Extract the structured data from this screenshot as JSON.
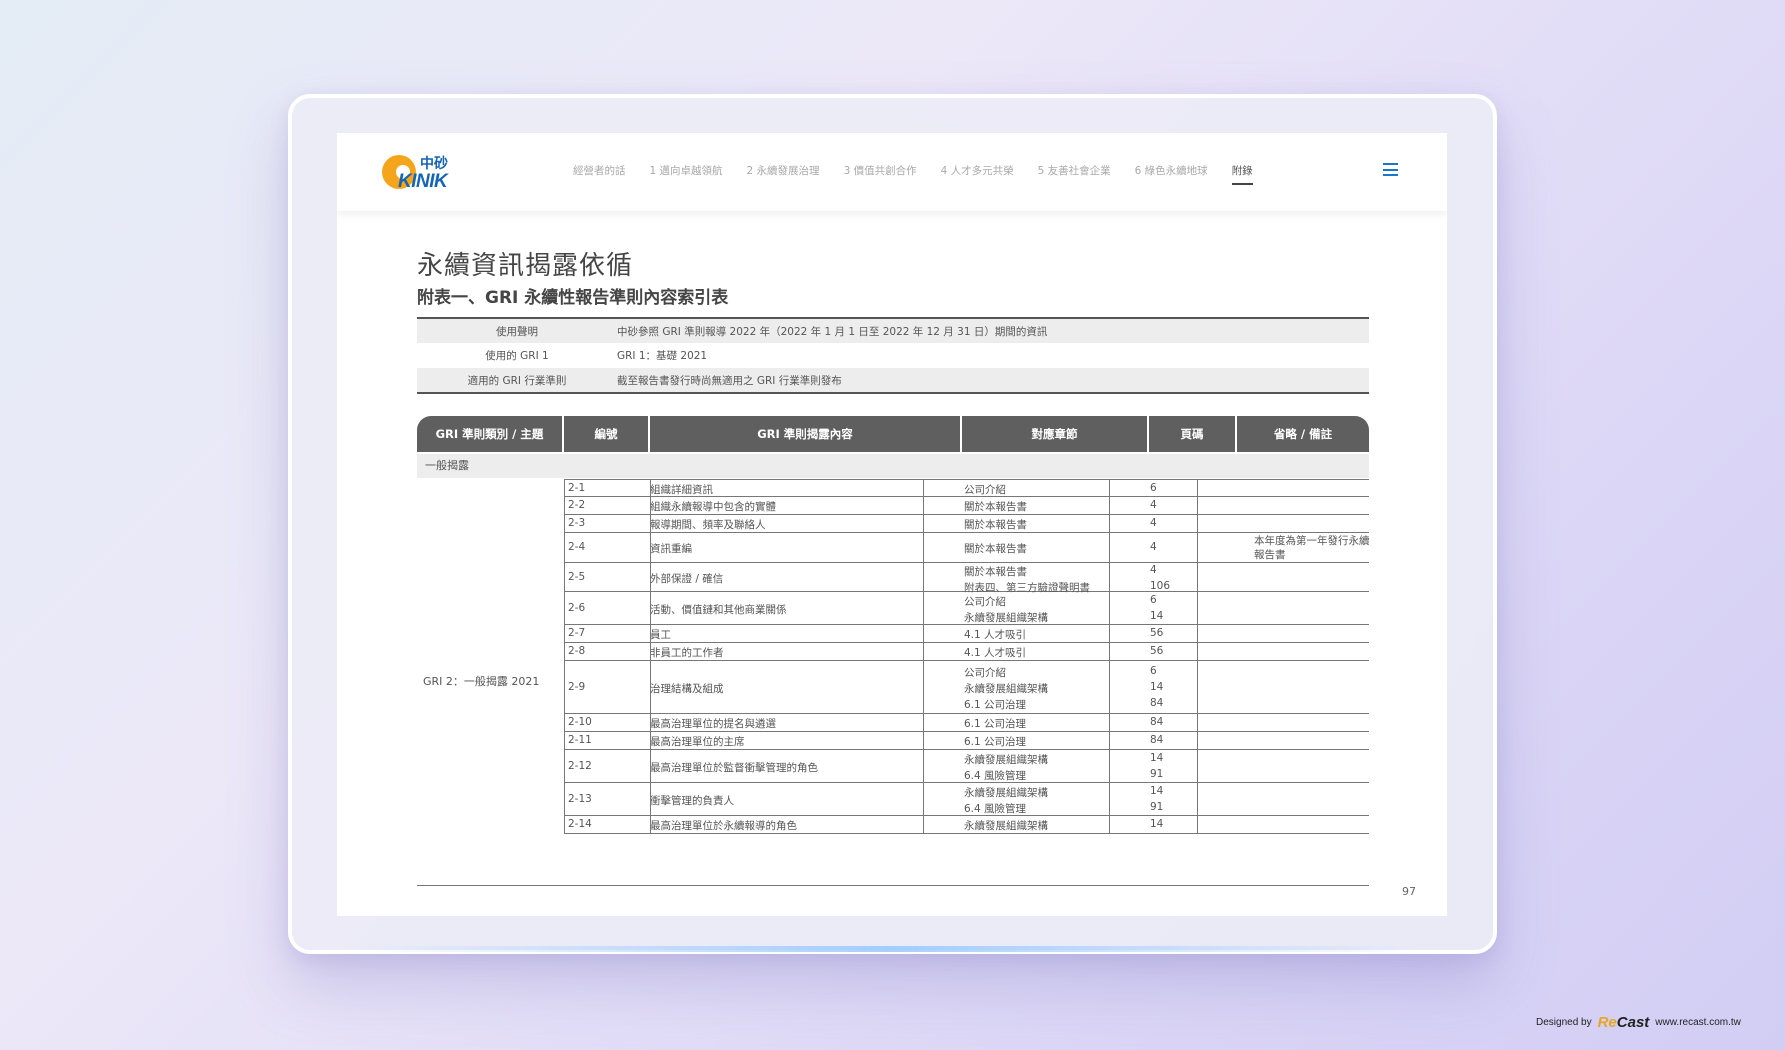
{
  "brand": {
    "logo_zh": "中砂",
    "logo_en": "KINIK"
  },
  "nav": {
    "items": [
      "經營者的話",
      "1 邁向卓越領航",
      "2 永續發展治理",
      "3 價值共創合作",
      "4 人才多元共榮",
      "5 友善社會企業",
      "6 綠色永續地球",
      "附錄"
    ],
    "active": "附錄",
    "menu_icon": "hamburger-menu-icon",
    "accent": "#1d75c8"
  },
  "page": {
    "title": "永續資訊揭露依循",
    "subtitle": "附表一、GRI 永續性報告準則內容索引表",
    "page_number": "97"
  },
  "statement": [
    {
      "key": "使用聲明",
      "value": "中砂參照 GRI 準則報導 2022 年（2022 年 1 月 1 日至 2022 年 12 月 31 日）期間的資訊"
    },
    {
      "key": "使用的 GRI 1",
      "value": "GRI 1：基礎 2021"
    },
    {
      "key": "適用的 GRI 行業準則",
      "value": "截至報告書發行時尚無適用之 GRI 行業準則發布"
    }
  ],
  "table": {
    "columns": [
      "GRI 準則類別 / 主題",
      "編號",
      "GRI 準則揭露內容",
      "對應章節",
      "頁碼",
      "省略 / 備註"
    ],
    "section": "一般揭露",
    "category": "GRI 2：一般揭露 2021",
    "rows": [
      {
        "no": "2-1",
        "title": "組織詳細資訊",
        "chapters": [
          "公司介紹"
        ],
        "pages": [
          "6"
        ],
        "note": ""
      },
      {
        "no": "2-2",
        "title": "組織永續報導中包含的實體",
        "chapters": [
          "關於本報告書"
        ],
        "pages": [
          "4"
        ],
        "note": ""
      },
      {
        "no": "2-3",
        "title": "報導期間、頻率及聯絡人",
        "chapters": [
          "關於本報告書"
        ],
        "pages": [
          "4"
        ],
        "note": ""
      },
      {
        "no": "2-4",
        "title": "資訊重編",
        "chapters": [
          "關於本報告書"
        ],
        "pages": [
          "4"
        ],
        "note": "本年度為第一年發行永續報告書"
      },
      {
        "no": "2-5",
        "title": "外部保證 / 確信",
        "chapters": [
          "關於本報告書",
          "附表四、第三方驗證聲明書"
        ],
        "pages": [
          "4",
          "106"
        ],
        "note": ""
      },
      {
        "no": "2-6",
        "title": "活動、價值鏈和其他商業關係",
        "chapters": [
          "公司介紹",
          "永續發展組織架構"
        ],
        "pages": [
          "6",
          "14"
        ],
        "note": ""
      },
      {
        "no": "2-7",
        "title": "員工",
        "chapters": [
          "4.1 人才吸引"
        ],
        "pages": [
          "56"
        ],
        "note": ""
      },
      {
        "no": "2-8",
        "title": "非員工的工作者",
        "chapters": [
          "4.1 人才吸引"
        ],
        "pages": [
          "56"
        ],
        "note": ""
      },
      {
        "no": "2-9",
        "title": "治理結構及組成",
        "chapters": [
          "公司介紹",
          "永續發展組織架構",
          "6.1 公司治理"
        ],
        "pages": [
          "6",
          "14",
          "84"
        ],
        "note": ""
      },
      {
        "no": "2-10",
        "title": "最高治理單位的提名與遴選",
        "chapters": [
          "6.1 公司治理"
        ],
        "pages": [
          "84"
        ],
        "note": ""
      },
      {
        "no": "2-11",
        "title": "最高治理單位的主席",
        "chapters": [
          "6.1 公司治理"
        ],
        "pages": [
          "84"
        ],
        "note": ""
      },
      {
        "no": "2-12",
        "title": "最高治理單位於監督衝擊管理的角色",
        "chapters": [
          "永續發展組織架構",
          "6.4 風險管理"
        ],
        "pages": [
          "14",
          "91"
        ],
        "note": ""
      },
      {
        "no": "2-13",
        "title": "衝擊管理的負責人",
        "chapters": [
          "永續發展組織架構",
          "6.4 風險管理"
        ],
        "pages": [
          "14",
          "91"
        ],
        "note": ""
      },
      {
        "no": "2-14",
        "title": "最高治理單位於永續報導的角色",
        "chapters": [
          "永續發展組織架構"
        ],
        "pages": [
          "14"
        ],
        "note": ""
      }
    ]
  },
  "credit": {
    "designed_by": "Designed by",
    "brand_re": "Re",
    "brand_cast": "Cast",
    "url": "www.recast.com.tw"
  }
}
